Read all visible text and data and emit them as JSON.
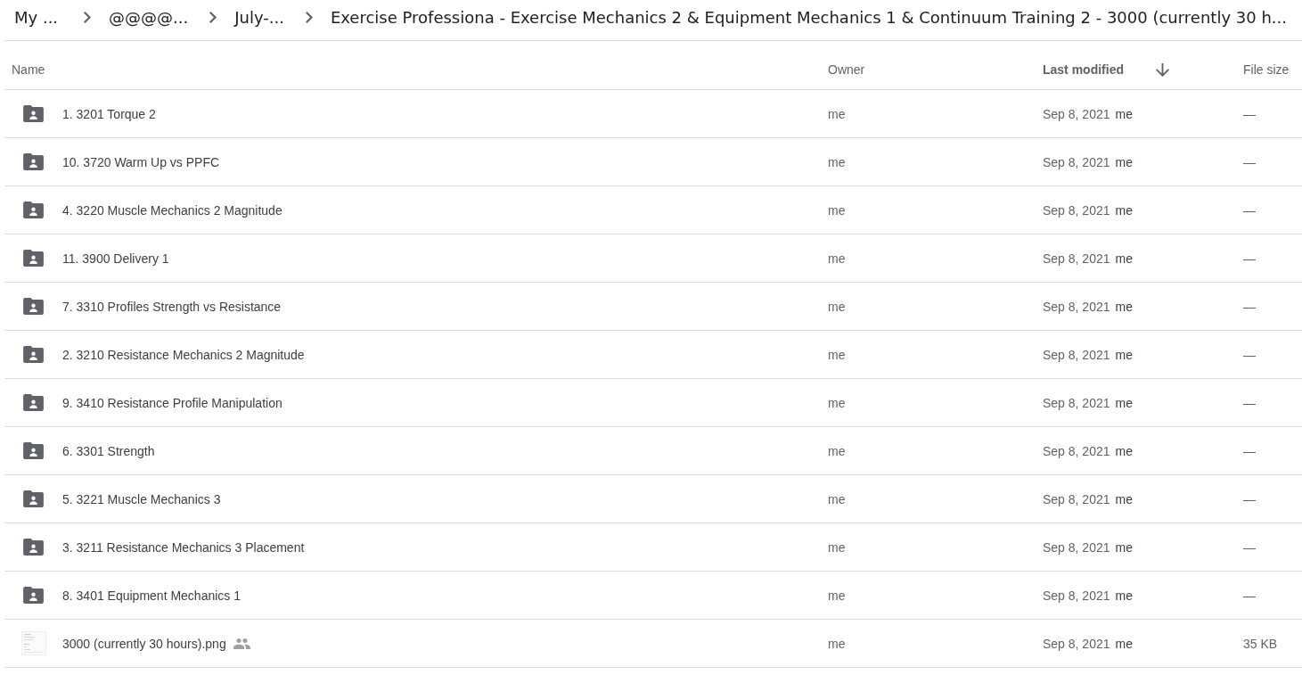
{
  "breadcrumb": [
    {
      "label": "My ..."
    },
    {
      "label": "@@@@..."
    },
    {
      "label": "July-..."
    },
    {
      "label": "Exercise Professiona - Exercise Mechanics 2 & Equipment Mechanics 1 & Continuum Training 2 - 3000 (currently 30 h..."
    }
  ],
  "table": {
    "columns": [
      {
        "label": "Name",
        "sorted": false
      },
      {
        "label": "Owner",
        "sorted": false
      },
      {
        "label": "Last modified",
        "sorted": true
      },
      {
        "label": "File size",
        "sorted": false
      }
    ],
    "rows": [
      {
        "kind": "folder",
        "name": "1. 3201 Torque 2",
        "shared": false,
        "owner": "me",
        "modified": "Sep 8, 2021",
        "modified_by": "me",
        "file_size": "—"
      },
      {
        "kind": "folder",
        "name": "10. 3720 Warm Up vs PPFC",
        "shared": false,
        "owner": "me",
        "modified": "Sep 8, 2021",
        "modified_by": "me",
        "file_size": "—"
      },
      {
        "kind": "folder",
        "name": "4. 3220 Muscle Mechanics 2 Magnitude",
        "shared": false,
        "owner": "me",
        "modified": "Sep 8, 2021",
        "modified_by": "me",
        "file_size": "—"
      },
      {
        "kind": "folder",
        "name": "11. 3900 Delivery 1",
        "shared": false,
        "owner": "me",
        "modified": "Sep 8, 2021",
        "modified_by": "me",
        "file_size": "—"
      },
      {
        "kind": "folder",
        "name": "7. 3310 Profiles Strength vs Resistance",
        "shared": false,
        "owner": "me",
        "modified": "Sep 8, 2021",
        "modified_by": "me",
        "file_size": "—"
      },
      {
        "kind": "folder",
        "name": "2. 3210 Resistance Mechanics 2 Magnitude",
        "shared": false,
        "owner": "me",
        "modified": "Sep 8, 2021",
        "modified_by": "me",
        "file_size": "—"
      },
      {
        "kind": "folder",
        "name": "9. 3410 Resistance Profile Manipulation",
        "shared": false,
        "owner": "me",
        "modified": "Sep 8, 2021",
        "modified_by": "me",
        "file_size": "—"
      },
      {
        "kind": "folder",
        "name": "6. 3301 Strength",
        "shared": false,
        "owner": "me",
        "modified": "Sep 8, 2021",
        "modified_by": "me",
        "file_size": "—"
      },
      {
        "kind": "folder",
        "name": "5. 3221 Muscle Mechanics 3",
        "shared": false,
        "owner": "me",
        "modified": "Sep 8, 2021",
        "modified_by": "me",
        "file_size": "—"
      },
      {
        "kind": "folder",
        "name": "3. 3211 Resistance Mechanics 3 Placement",
        "shared": false,
        "owner": "me",
        "modified": "Sep 8, 2021",
        "modified_by": "me",
        "file_size": "—"
      },
      {
        "kind": "folder",
        "name": "8. 3401 Equipment Mechanics 1",
        "shared": false,
        "owner": "me",
        "modified": "Sep 8, 2021",
        "modified_by": "me",
        "file_size": "—"
      },
      {
        "kind": "image",
        "name": "3000 (currently 30 hours).png",
        "shared": true,
        "owner": "me",
        "modified": "Sep 8, 2021",
        "modified_by": "me",
        "file_size": "35 KB"
      }
    ]
  }
}
